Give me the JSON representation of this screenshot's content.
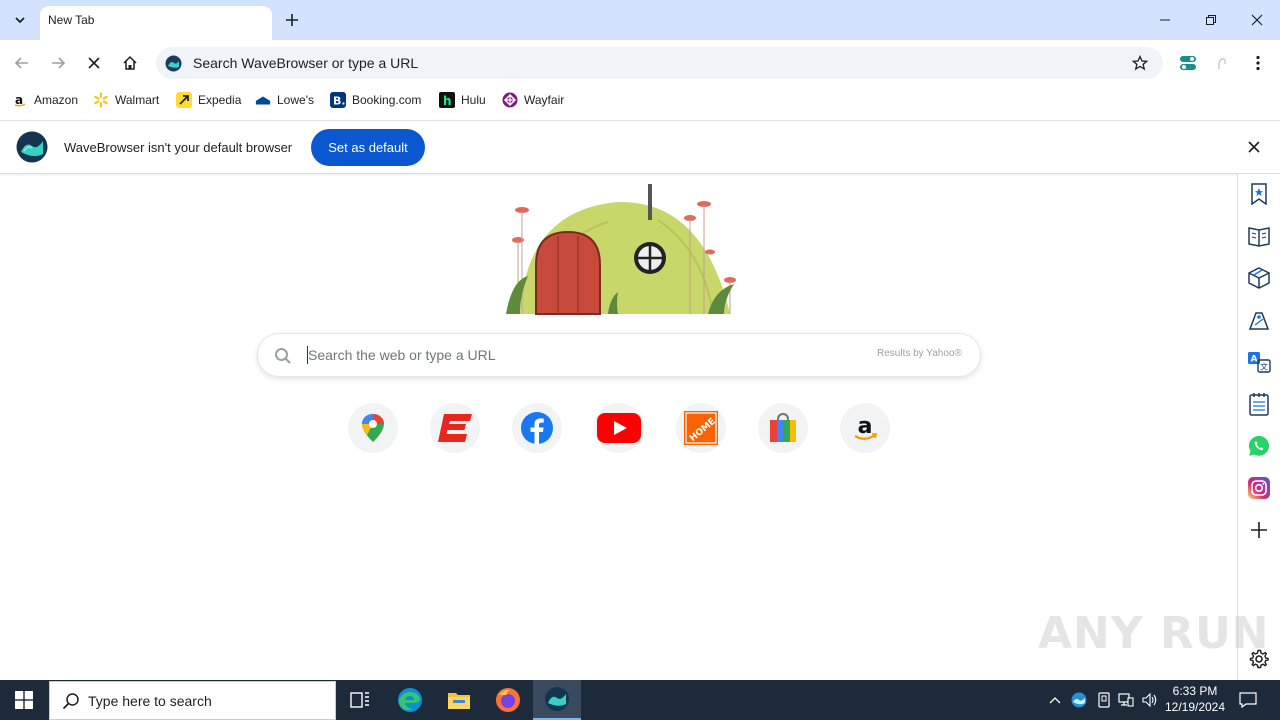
{
  "tabs": [
    {
      "label": "New Tab"
    }
  ],
  "omnibox": {
    "placeholder": "Search WaveBrowser or type a URL"
  },
  "bookmarks": [
    {
      "label": "Amazon",
      "icon": "amazon-icon"
    },
    {
      "label": "Walmart",
      "icon": "walmart-icon"
    },
    {
      "label": "Expedia",
      "icon": "expedia-icon"
    },
    {
      "label": "Lowe's",
      "icon": "lowes-icon"
    },
    {
      "label": "Booking.com",
      "icon": "booking-icon"
    },
    {
      "label": "Hulu",
      "icon": "hulu-icon"
    },
    {
      "label": "Wayfair",
      "icon": "wayfair-icon"
    }
  ],
  "infobar": {
    "message": "WaveBrowser isn't your default browser",
    "button_label": "Set as default"
  },
  "newtab": {
    "search_placeholder": "Search the web or type a URL",
    "results_by": "Results by Yahoo®",
    "shortcuts": [
      "google-maps-icon",
      "espn-icon",
      "facebook-icon",
      "youtube-icon",
      "home-depot-icon",
      "shopping-bag-icon",
      "amazon-icon"
    ]
  },
  "sidebar_icons": [
    "bookmark-star-icon",
    "book-icon",
    "package-icon",
    "shopping-tag-icon",
    "translate-icon",
    "checklist-icon",
    "whatsapp-icon",
    "instagram-icon",
    "add-icon",
    "gear-icon"
  ],
  "watermark": "ANY RUN",
  "taskbar": {
    "search_placeholder": "Type here to search",
    "time": "6:33 PM",
    "date": "12/19/2024"
  },
  "colors": {
    "accent": "#0b57d0",
    "tabstrip": "#d3e3fd",
    "taskbar": "#1c2a3a"
  }
}
